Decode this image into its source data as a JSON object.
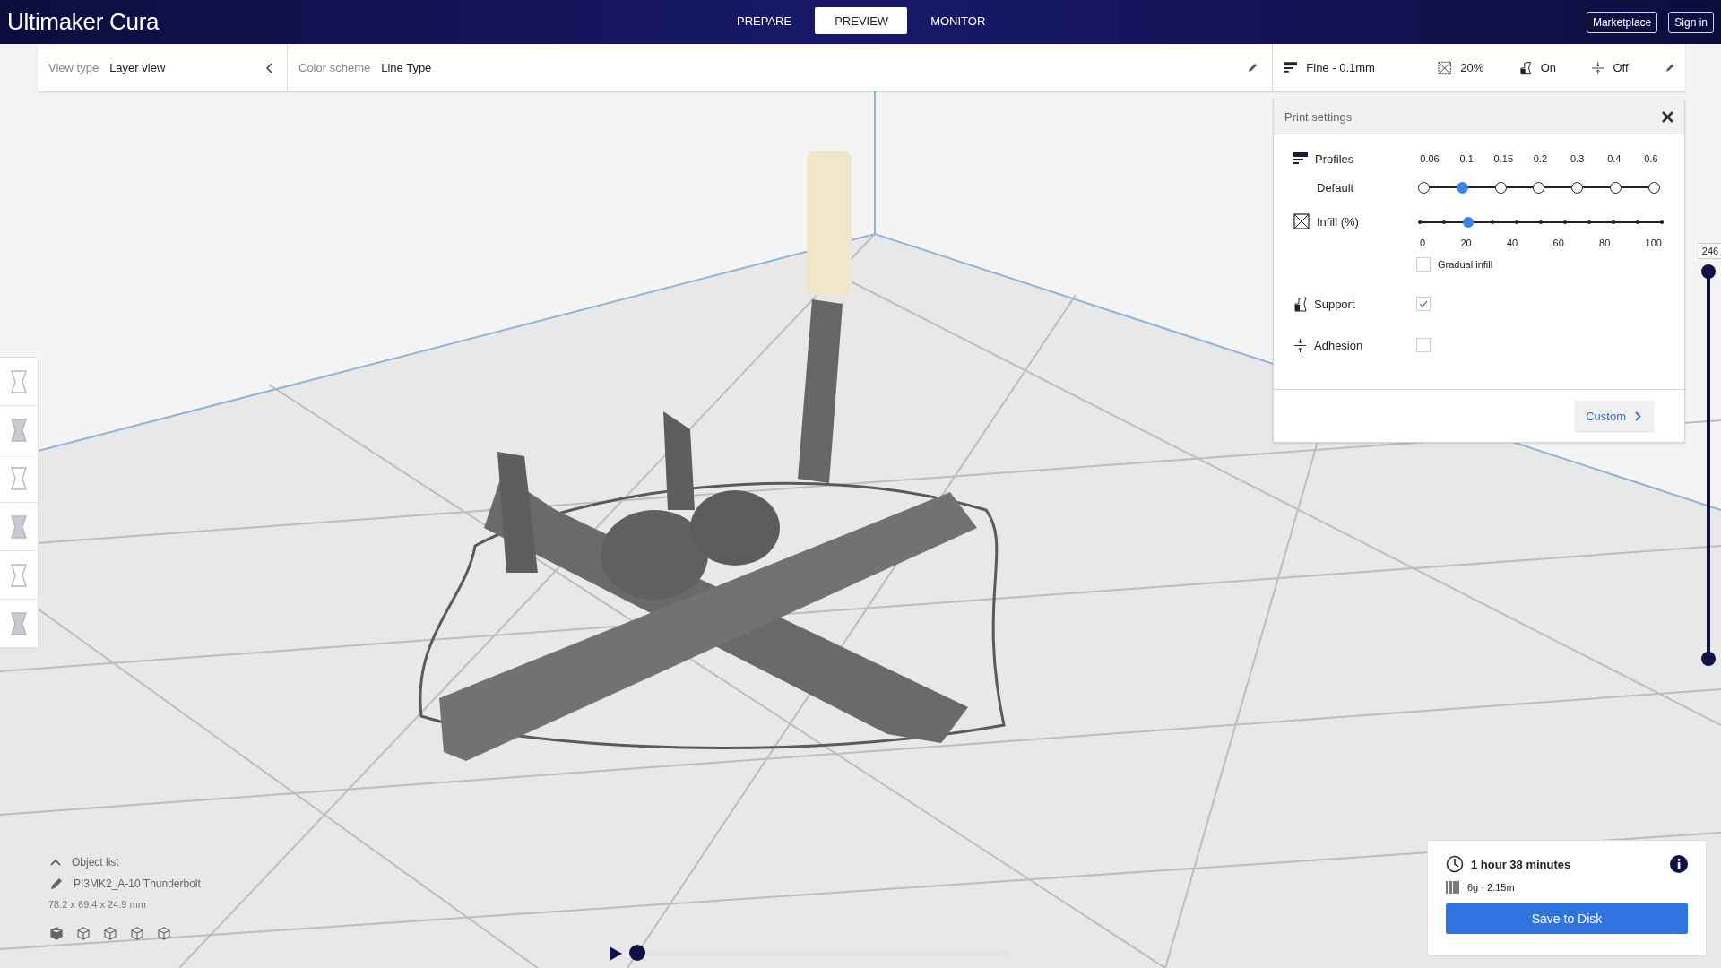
{
  "app": {
    "title": "Ultimaker Cura"
  },
  "stages": [
    {
      "label": "PREPARE",
      "selected": false
    },
    {
      "label": "PREVIEW",
      "selected": true
    },
    {
      "label": "MONITOR",
      "selected": false
    }
  ],
  "account_buttons": [
    "Marketplace",
    "Sign in"
  ],
  "view_bar": {
    "view_type_label": "View type",
    "view_type": "Layer view",
    "color_scheme_label": "Color scheme",
    "color_scheme": "Line Type"
  },
  "settings_summary": {
    "profile": "Fine - 0.1mm",
    "infill": "20%",
    "support": "On",
    "adhesion": "Off"
  },
  "print_settings": {
    "title": "Print settings",
    "profiles_label": "Profiles",
    "profile_name": "Default",
    "profile_steps": [
      {
        "label": "0.06",
        "selected": false
      },
      {
        "label": "0.1",
        "selected": true
      },
      {
        "label": "0.15",
        "selected": false
      },
      {
        "label": "0.2",
        "selected": false
      },
      {
        "label": "0.3",
        "selected": false
      },
      {
        "label": "0.4",
        "selected": false
      },
      {
        "label": "0.6",
        "selected": false
      }
    ],
    "infill_label": "Infill (%)",
    "infill_slider": {
      "level": 0.2
    },
    "infill_ticks": [
      "0",
      "20",
      "40",
      "60",
      "80",
      "100"
    ],
    "gradual_infill": {
      "label": "Gradual infill",
      "checked": false
    },
    "support": {
      "label": "Support",
      "checked": true
    },
    "adhesion": {
      "label": "Adhesion",
      "checked": false
    },
    "custom_button": "Custom"
  },
  "layer_slider": {
    "reading": "246",
    "level": 1
  },
  "object_list": {
    "toggle": "Object list",
    "expanded": true,
    "object_name": "PI3MK2_A-10 Thunderbolt",
    "dimensions": "78.2 x 69.4 x 24.9 mm"
  },
  "simulation": {
    "level": 0
  },
  "print_estimate": {
    "time": "1 hour 38 minutes",
    "material": "6g · 2.15m",
    "button": "Save to Disk"
  }
}
